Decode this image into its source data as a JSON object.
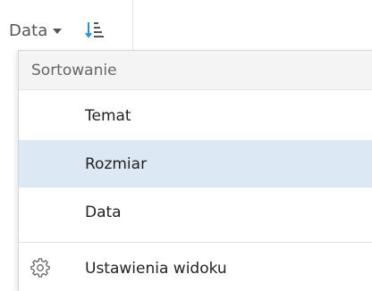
{
  "toolbar": {
    "sort_field_label": "Data"
  },
  "menu": {
    "header": "Sortowanie",
    "items": [
      {
        "label": "Temat"
      },
      {
        "label": "Rozmiar"
      },
      {
        "label": "Data"
      }
    ],
    "settings_label": "Ustawienia widoku",
    "selected_item": "Rozmiar"
  },
  "icons": {
    "caret": "chevron-down-icon",
    "sort_direction": "sort-descending-icon",
    "settings": "gear-icon"
  },
  "colors": {
    "selected_background": "#dce9f5",
    "header_background": "#f4f4f4",
    "accent_icon": "#2b8fd6"
  }
}
